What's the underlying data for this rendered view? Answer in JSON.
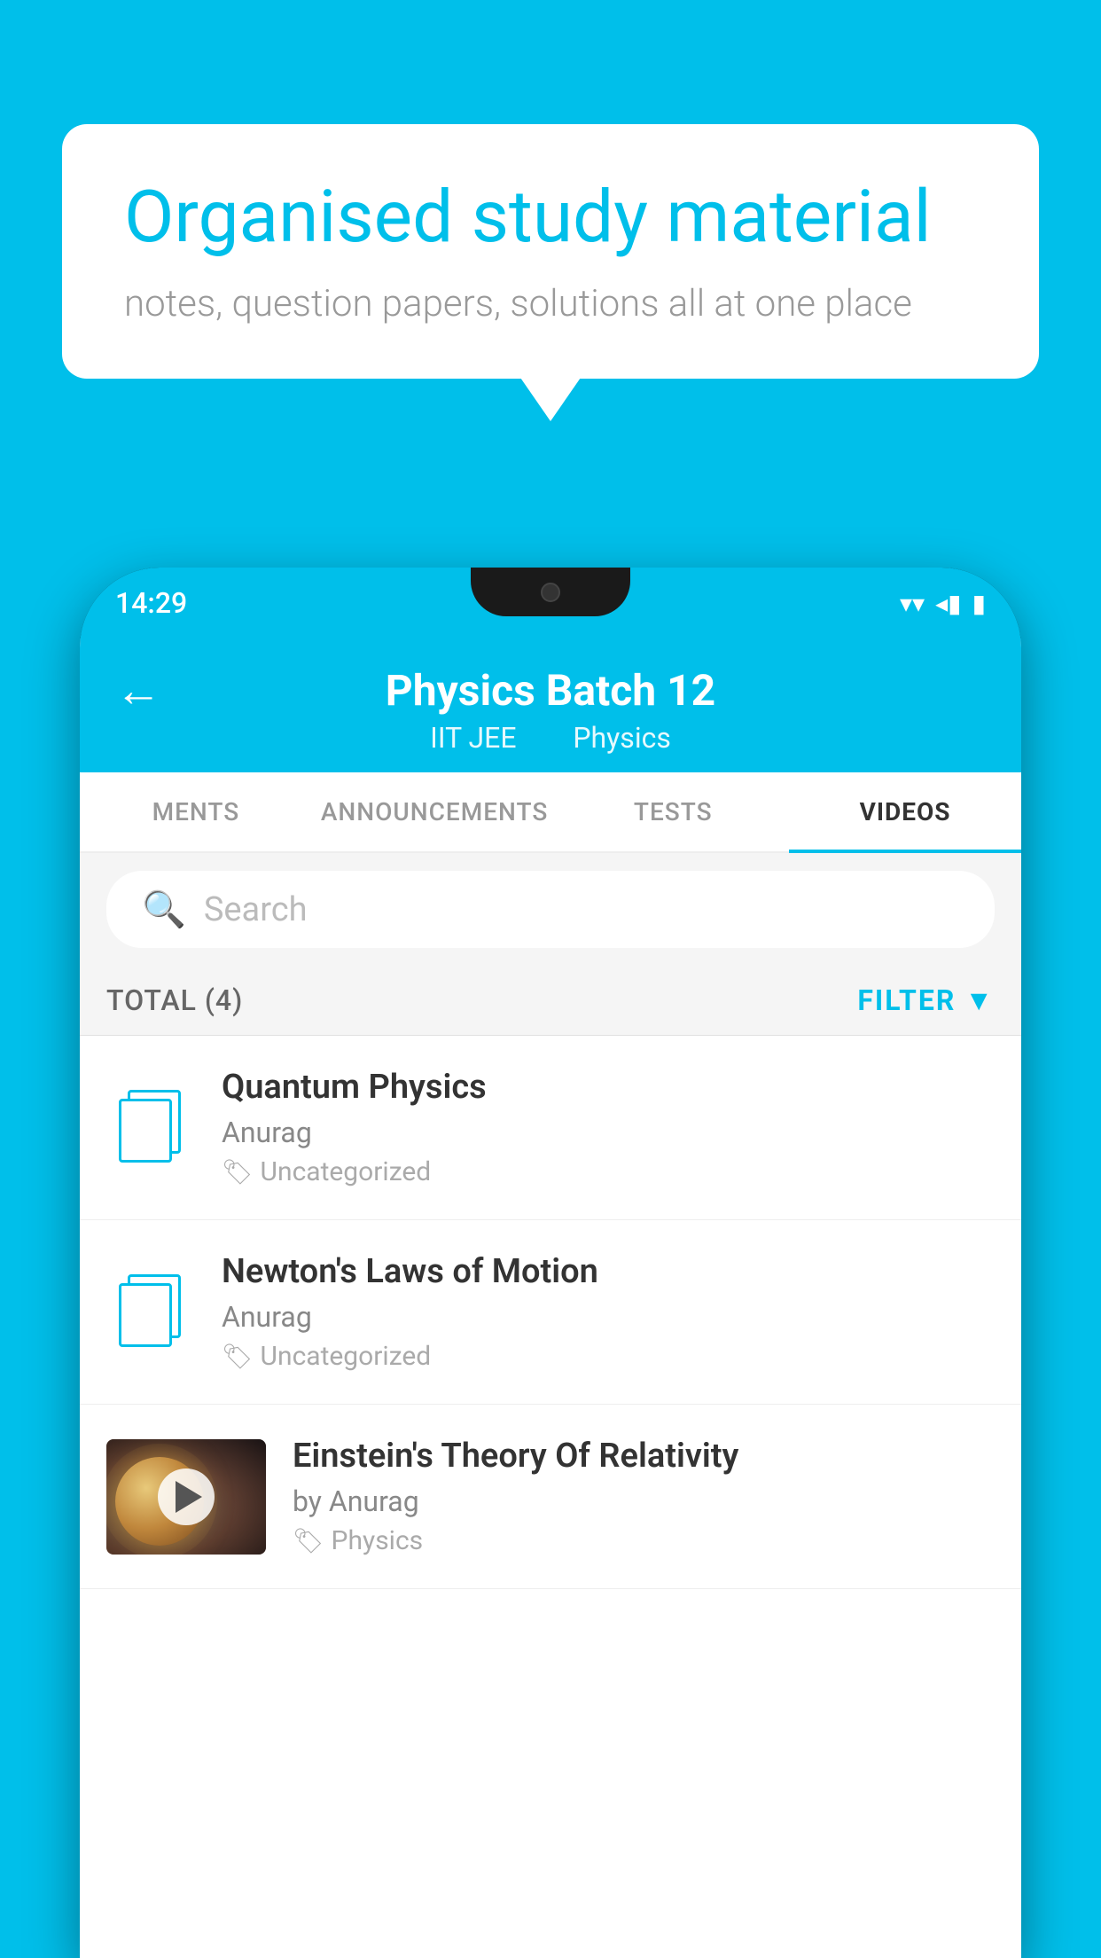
{
  "background_color": "#00BFEA",
  "speech_bubble": {
    "headline": "Organised study material",
    "subtext": "notes, question papers, solutions all at one place"
  },
  "phone": {
    "status_bar": {
      "time": "14:29",
      "wifi_icon": "▼",
      "signal_icon": "▲",
      "battery_icon": "▮"
    },
    "header": {
      "back_label": "←",
      "title": "Physics Batch 12",
      "subtitle_part1": "IIT JEE",
      "subtitle_part2": "Physics"
    },
    "tabs": [
      {
        "label": "MENTS",
        "active": false
      },
      {
        "label": "ANNOUNCEMENTS",
        "active": false
      },
      {
        "label": "TESTS",
        "active": false
      },
      {
        "label": "VIDEOS",
        "active": true
      }
    ],
    "search": {
      "placeholder": "Search"
    },
    "filter": {
      "total_label": "TOTAL (4)",
      "filter_label": "FILTER"
    },
    "videos": [
      {
        "id": 1,
        "title": "Quantum Physics",
        "author": "Anurag",
        "tag": "Uncategorized",
        "has_thumbnail": false
      },
      {
        "id": 2,
        "title": "Newton's Laws of Motion",
        "author": "Anurag",
        "tag": "Uncategorized",
        "has_thumbnail": false
      },
      {
        "id": 3,
        "title": "Einstein's Theory Of Relativity",
        "author": "by Anurag",
        "tag": "Physics",
        "has_thumbnail": true
      }
    ]
  }
}
